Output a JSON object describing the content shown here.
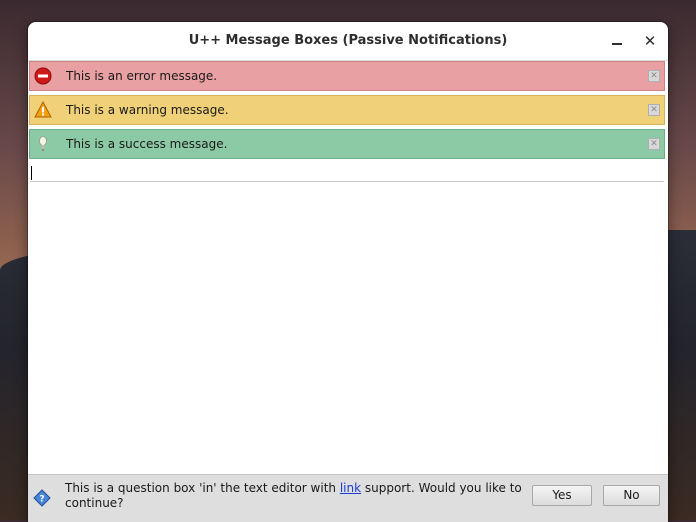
{
  "window": {
    "title": "U++ Message Boxes (Passive Notifications)",
    "minimize_icon": "minimize-icon",
    "close_glyph": "✕"
  },
  "messages": [
    {
      "type": "error",
      "text": "This is an error message.",
      "icon": "error-icon",
      "color": "#e8a0a3"
    },
    {
      "type": "warning",
      "text": "This is a warning message.",
      "icon": "warning-icon",
      "color": "#f0d178"
    },
    {
      "type": "success",
      "text": "This is a success message.",
      "icon": "success-icon",
      "color": "#8ccaa5"
    }
  ],
  "editor": {
    "value": ""
  },
  "question": {
    "text_before": "This is a question box 'in' the text editor with ",
    "link_text": "link",
    "text_after": " support. Would you like to continue?",
    "icon": "question-icon",
    "yes_label": "Yes",
    "no_label": "No"
  }
}
